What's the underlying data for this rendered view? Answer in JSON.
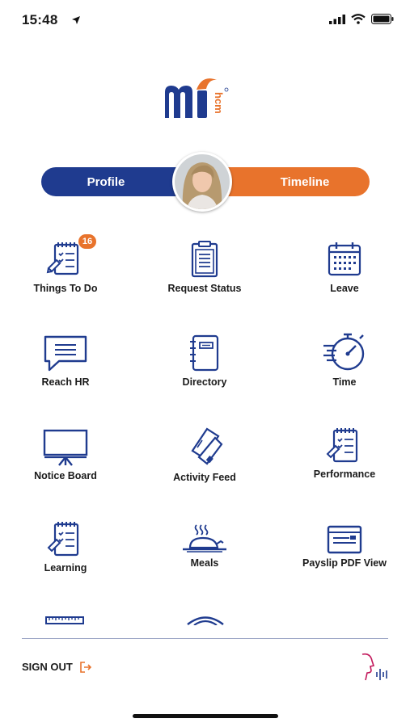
{
  "status_bar": {
    "time": "15:48"
  },
  "toggle": {
    "profile_label": "Profile",
    "timeline_label": "Timeline"
  },
  "badges": {
    "things_to_do": "16"
  },
  "menu": {
    "things_to_do": "Things To Do",
    "request_status": "Request Status",
    "leave": "Leave",
    "reach_hr": "Reach HR",
    "directory": "Directory",
    "time": "Time",
    "notice_board": "Notice Board",
    "activity_feed": "Activity Feed",
    "performance": "Performance",
    "learning": "Learning",
    "meals": "Meals",
    "payslip": "Payslip PDF View"
  },
  "footer": {
    "sign_out_label": "SIGN OUT"
  },
  "colors": {
    "primary": "#1f3b8f",
    "accent": "#e8732c"
  },
  "icons": {
    "things_to_do": "checklist-icon",
    "request_status": "clipboard-icon",
    "leave": "calendar-icon",
    "reach_hr": "chat-bubble-icon",
    "directory": "notebook-icon",
    "time": "stopwatch-icon",
    "notice_board": "easel-board-icon",
    "activity_feed": "tags-icon",
    "performance": "checklist-icon",
    "learning": "checklist-icon",
    "meals": "food-platter-icon",
    "payslip": "payslip-icon"
  }
}
